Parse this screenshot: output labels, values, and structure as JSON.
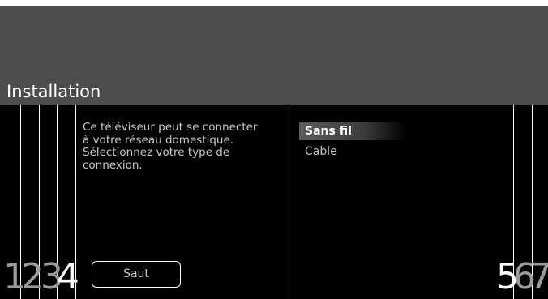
{
  "header": {
    "title": "Installation"
  },
  "steps": [
    "1",
    "2",
    "3",
    "4",
    "5",
    "6",
    "7"
  ],
  "description": {
    "lines": [
      "Ce téléviseur peut se connecter",
      "à votre réseau domestique.",
      "Sélectionnez votre type de",
      "connexion."
    ]
  },
  "buttons": {
    "skip_label": "Saut"
  },
  "menu": {
    "items": [
      {
        "label": "Sans fil",
        "selected": true
      },
      {
        "label": "Cable",
        "selected": false
      }
    ]
  },
  "colors": {
    "header_band": "#4d4d4d",
    "background": "#000000",
    "text": "#c8c8c8",
    "highlight": "#5c5c5c"
  }
}
